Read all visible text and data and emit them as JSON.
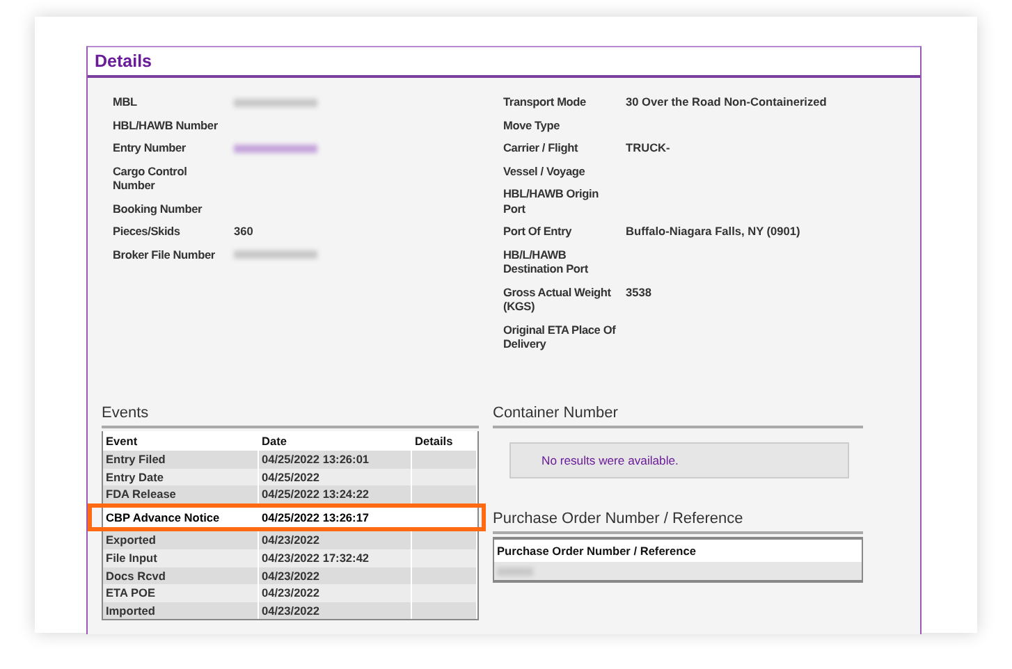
{
  "panel": {
    "title": "Details"
  },
  "details_left": [
    {
      "label": "MBL",
      "kind": "redacted"
    },
    {
      "label": "HBL/HAWB Number",
      "kind": "empty"
    },
    {
      "label": "Entry Number",
      "kind": "redacted-link"
    },
    {
      "label": "Cargo Control Number",
      "kind": "empty"
    },
    {
      "label": "Booking Number",
      "kind": "empty"
    },
    {
      "label": "Pieces/Skids",
      "kind": "text",
      "value": "360"
    },
    {
      "label": "Broker File Number",
      "kind": "redacted"
    }
  ],
  "details_right": [
    {
      "label": "Transport Mode",
      "kind": "text",
      "value": "30 Over the Road Non-Containerized"
    },
    {
      "label": "Move Type",
      "kind": "empty"
    },
    {
      "label": "Carrier / Flight",
      "kind": "text",
      "value": "TRUCK-"
    },
    {
      "label": "Vessel / Voyage",
      "kind": "empty"
    },
    {
      "label": "HBL/HAWB Origin Port",
      "kind": "empty"
    },
    {
      "label": "Port Of Entry",
      "kind": "text",
      "value": "Buffalo-Niagara Falls, NY (0901)"
    },
    {
      "label": "HB/L/HAWB Destination Port",
      "kind": "empty"
    },
    {
      "label": "Gross Actual Weight (KGS)",
      "kind": "text",
      "value": "3538"
    },
    {
      "label": "Original ETA Place Of Delivery",
      "kind": "empty"
    }
  ],
  "events": {
    "title": "Events",
    "columns": [
      "Event",
      "Date",
      "Details"
    ],
    "rows": [
      {
        "event": "Entry Filed",
        "date": "04/25/2022 13:26:01",
        "highlighted": false
      },
      {
        "event": "Entry Date",
        "date": "04/25/2022",
        "highlighted": false
      },
      {
        "event": "FDA Release",
        "date": "04/25/2022 13:24:22",
        "highlighted": false
      },
      {
        "event": "CBP Advance Notice",
        "date": "04/25/2022 13:26:17",
        "highlighted": true
      },
      {
        "event": "Exported",
        "date": "04/23/2022",
        "highlighted": false
      },
      {
        "event": "File Input",
        "date": "04/23/2022 17:32:42",
        "highlighted": false
      },
      {
        "event": "Docs Rcvd",
        "date": "04/23/2022",
        "highlighted": false
      },
      {
        "event": "ETA POE",
        "date": "04/23/2022",
        "highlighted": false
      },
      {
        "event": "Imported",
        "date": "04/23/2022",
        "highlighted": false
      }
    ]
  },
  "container": {
    "title": "Container Number",
    "message": "No results were available."
  },
  "purchase_orders": {
    "title": "Purchase Order Number / Reference",
    "column": "Purchase Order Number / Reference",
    "rows": [
      {
        "kind": "redacted"
      }
    ]
  }
}
